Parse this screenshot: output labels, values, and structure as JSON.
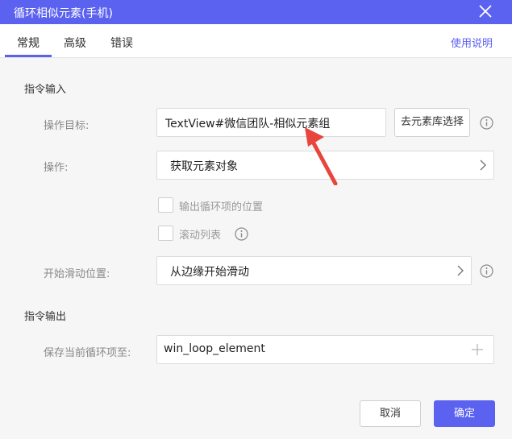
{
  "window": {
    "title": "循环相似元素(手机)"
  },
  "tabs": [
    {
      "label": "常规",
      "active": true
    },
    {
      "label": "高级",
      "active": false
    },
    {
      "label": "错误",
      "active": false
    }
  ],
  "help_link": "使用说明",
  "input_section": {
    "title": "指令输入",
    "target": {
      "label": "操作目标:",
      "value": "TextView#微信团队-相似元素组",
      "library_button": "去元素库选择"
    },
    "operation": {
      "label": "操作:",
      "value": "获取元素对象"
    },
    "options": [
      {
        "label": "输出循环项的位置",
        "checked": false
      },
      {
        "label": "滚动列表",
        "checked": false
      }
    ],
    "scroll_start": {
      "label": "开始滑动位置:",
      "value": "从边缘开始滑动"
    }
  },
  "output_section": {
    "title": "指令输出",
    "save_to": {
      "label": "保存当前循环项至:",
      "value": "win_loop_element"
    }
  },
  "footer": {
    "cancel": "取消",
    "confirm": "确定"
  },
  "colors": {
    "accent": "#5c62f0",
    "annotation": "#e8453c"
  }
}
